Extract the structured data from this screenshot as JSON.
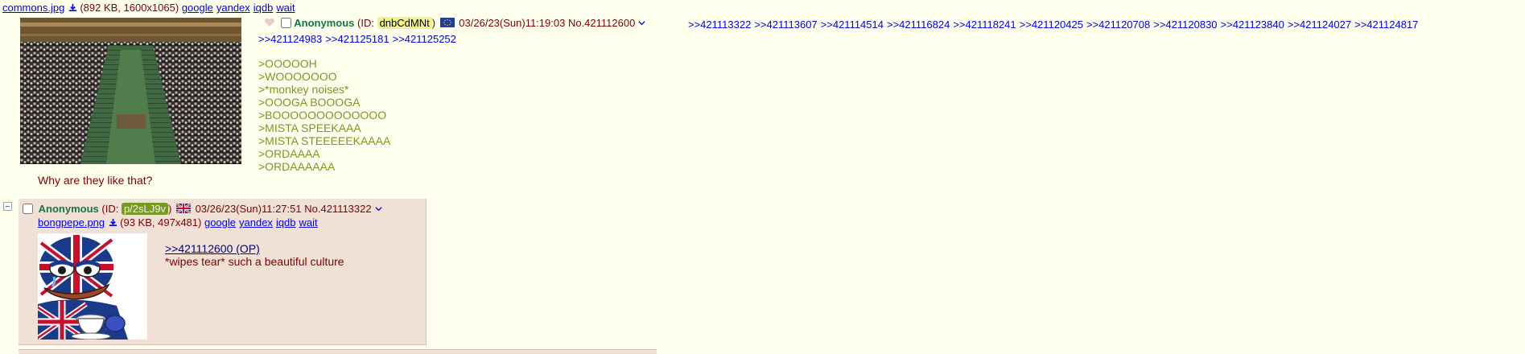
{
  "op": {
    "file": {
      "name": "commons.jpg",
      "meta": "(892 KB, 1600x1065)",
      "links": [
        "google",
        "yandex",
        "iqdb",
        "wait"
      ]
    },
    "name": "Anonymous",
    "id_prefix": "(ID: ",
    "id": "dnbCdMNt",
    "id_suffix": ")",
    "id_bg": "#f1f28a",
    "flag": "eu-flag",
    "datetime": "03/26/23(Sun)11:19:03",
    "postno": "No.421112600",
    "backlinks": [
      ">>421113322",
      ">>421113607",
      ">>421114514",
      ">>421116824",
      ">>421118241",
      ">>421120425",
      ">>421120708",
      ">>421120830",
      ">>421123840",
      ">>421124027",
      ">>421124817",
      ">>421124983",
      ">>421125181",
      ">>421125252"
    ],
    "greentext": [
      ">OOOOOH",
      ">WOOOOOOO",
      ">*monkey noises*",
      ">OOOGA BOOOGA",
      ">BOOOOOOOOOOOOO",
      ">MISTA SPEEKAAA",
      ">MISTA STEEEEEKAAAA",
      ">ORDAAAA",
      ">ORDAAAAAA"
    ],
    "comment": "Why are they like that?"
  },
  "reply": {
    "name": "Anonymous",
    "id_prefix": "(ID: ",
    "id": "p/2sLJ9v",
    "id_suffix": ")",
    "id_bg": "#789922",
    "id_color": "#f0f0f0",
    "flag": "uk-flag",
    "datetime": "03/26/23(Sun)11:27:51",
    "postno": "No.421113322",
    "file": {
      "name": "bongpepe.png",
      "meta": "(93 KB, 497x481)",
      "links": [
        "google",
        "yandex",
        "iqdb",
        "wait"
      ]
    },
    "quote": ">>421112600 (OP)",
    "text": "*wipes tear* such a beautiful culture"
  },
  "colors": {
    "background": "#ffffee",
    "reply_bg": "#f0e0d6",
    "name": "#117743",
    "greentext": "#789922",
    "link": "#0000ee",
    "text": "#800000"
  }
}
